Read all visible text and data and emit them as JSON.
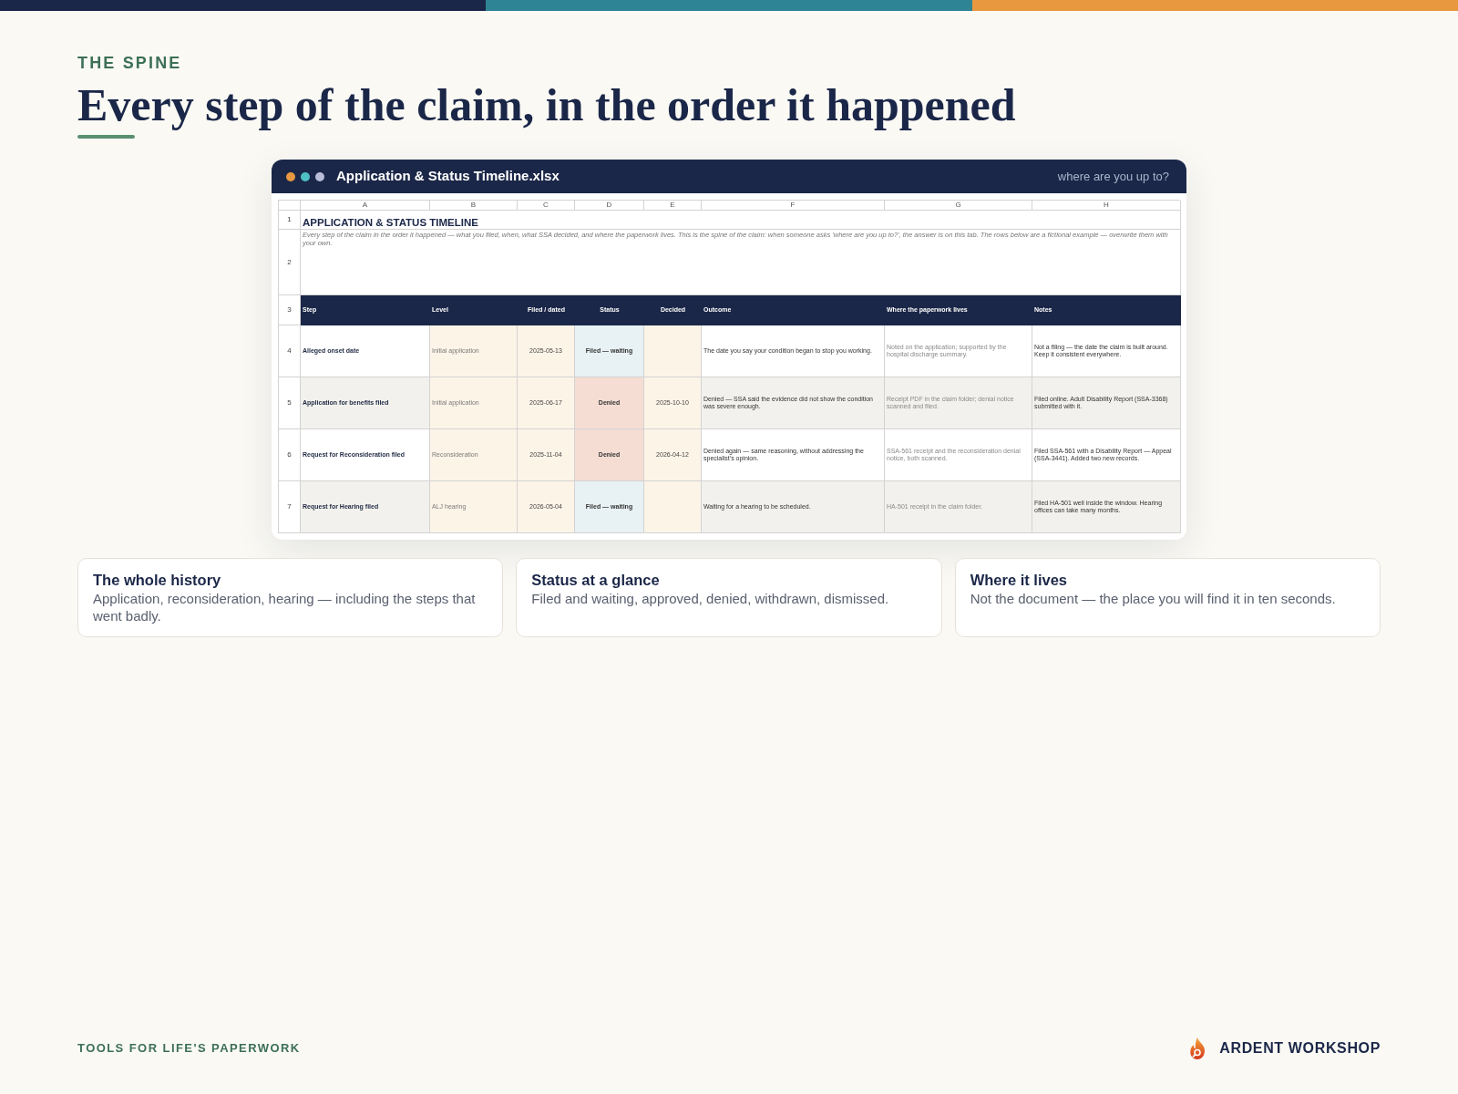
{
  "eyebrow": "THE SPINE",
  "heading": "Every step of the claim, in the order it happened",
  "window": {
    "title": "Application & Status Timeline.xlsx",
    "caption": "where are you up to?"
  },
  "sheet": {
    "column_letters": [
      "A",
      "B",
      "C",
      "D",
      "E",
      "F",
      "G",
      "H"
    ],
    "title_row": {
      "number": "1",
      "text": "APPLICATION & STATUS TIMELINE"
    },
    "note_row": {
      "number": "2",
      "text": "Every step of the claim in the order it happened — what you filed, when, what SSA decided, and where the paperwork lives. This is the spine of the claim: when someone asks 'where are you up to?', the answer is on this tab. The rows below are a fictional example — overwrite them with your own."
    },
    "header_row": {
      "number": "3",
      "cells": [
        "Step",
        "Level",
        "Filed / dated",
        "Status",
        "Decided",
        "Outcome",
        "Where the paperwork lives",
        "Notes"
      ]
    },
    "rows": [
      {
        "number": "4",
        "step": "Alleged onset date",
        "level": "Initial application",
        "filed": "2025-05-13",
        "status": {
          "text": "Filed — waiting",
          "color": "#e8f1f3"
        },
        "outcome": "The date you say your condition began to stop you working.",
        "location": "Noted on the application; supported by the hospital discharge summary.",
        "notes": "Not a filing — the date the claim is built around. Keep it consistent everywhere."
      },
      {
        "number": "5",
        "step": "Application for benefits filed",
        "level": "Initial application",
        "filed": "2025-06-17",
        "status": {
          "text": "Denied",
          "color": "#f5ddd3"
        },
        "decided": "2025-10-10",
        "outcome": "Denied — SSA said the evidence did not show the condition was severe enough.",
        "location": "Receipt PDF in the claim folder; denial notice scanned and filed.",
        "notes": "Filed online. Adult Disability Report (SSA-3368) submitted with it."
      },
      {
        "number": "6",
        "step": "Request for Reconsideration filed",
        "level": "Reconsideration",
        "filed": "2025-11-04",
        "status": {
          "text": "Denied",
          "color": "#f5ddd3"
        },
        "decided": "2026-04-12",
        "outcome": "Denied again — same reasoning, without addressing the specialist's opinion.",
        "location": "SSA-561 receipt and the reconsideration denial notice, both scanned.",
        "notes": "Filed SSA-561 with a Disability Report — Appeal (SSA-3441). Added two new records."
      },
      {
        "number": "7",
        "step": "Request for Hearing filed",
        "level": "ALJ hearing",
        "filed": "2026-05-04",
        "status": {
          "text": "Filed — waiting",
          "color": "#e8f1f3"
        },
        "outcome": "Waiting for a hearing to be scheduled.",
        "location": "HA-501 receipt in the claim folder.",
        "notes": "Filed HA-501 well inside the window. Hearing offices can take many months."
      }
    ]
  },
  "cards": [
    {
      "title": "The whole history",
      "text": "Application, reconsideration, hearing — including the steps that went badly."
    },
    {
      "title": "Status at a glance",
      "text": "Filed and waiting, approved, denied, withdrawn, dismissed."
    },
    {
      "title": "Where it lives",
      "text": "Not the document — the place you will find it in ten seconds."
    }
  ],
  "footer": {
    "tagline": "TOOLS FOR LIFE'S PAPERWORK",
    "brand": "ARDENT WORKSHOP"
  }
}
